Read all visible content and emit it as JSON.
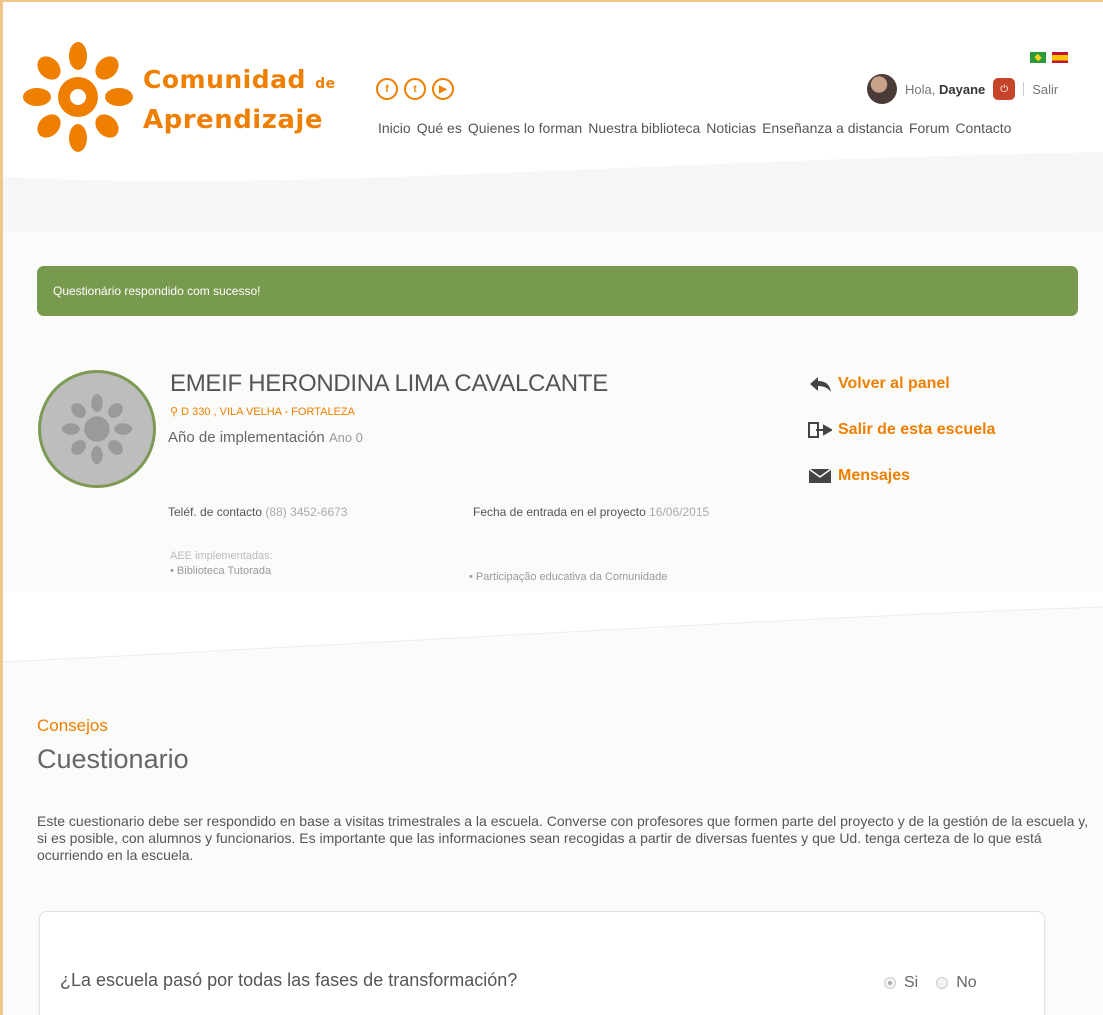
{
  "header": {
    "logo_line1": "Comunidad",
    "logo_line1_suffix": "de",
    "logo_line2": "Aprendizaje",
    "social": [
      "f",
      "t",
      "▶"
    ],
    "nav": [
      "Inicio",
      "Qué es",
      "Quienes lo forman",
      "Nuestra biblioteca",
      "Noticias",
      "Enseñanza a distancia",
      "Forum",
      "Contacto"
    ],
    "greeting": "Hola,",
    "user_name": "Dayane",
    "logout": "Salir",
    "brand_color": "#ee7f00"
  },
  "alert": {
    "message": "Questionário respondido com sucesso!",
    "color": "#789a4f"
  },
  "school": {
    "name": "EMEIF HERONDINA LIMA CAVALCANTE",
    "address": "D 330 , VILA VELHA - FORTALEZA",
    "impl_label": "Año de implementación",
    "impl_value": "Ano 0",
    "contact_label": "Teléf. de contacto",
    "contact_value": "(88) 3452-6673",
    "entry_label": "Fecha de entrada en el proyecto",
    "entry_value": "16/06/2015",
    "aee_label": "AEE implementadas:",
    "aee_items": [
      "• Biblioteca Tutorada",
      "• Participação educativa da Comunidade"
    ]
  },
  "actions": {
    "back": "Volver al panel",
    "leave": "Salir de esta escuela",
    "messages": "Mensajes"
  },
  "questionnaire": {
    "section": "Consejos",
    "title": "Cuestionario",
    "intro": "Este cuestionario debe ser respondido en base a visitas trimestrales a la escuela. Converse con profesores que formen parte del proyecto y de la gestión de la escuela y, si es posible, con alumnos y funcionarios. Es importante que las informaciones sean recogidas a partir de diversas fuentes y que Ud. tenga certeza de lo que está ocurriendo en la escuela.",
    "question": "¿La escuela pasó por todas las fases de transformación?",
    "option_yes": "Si",
    "option_no": "No"
  }
}
